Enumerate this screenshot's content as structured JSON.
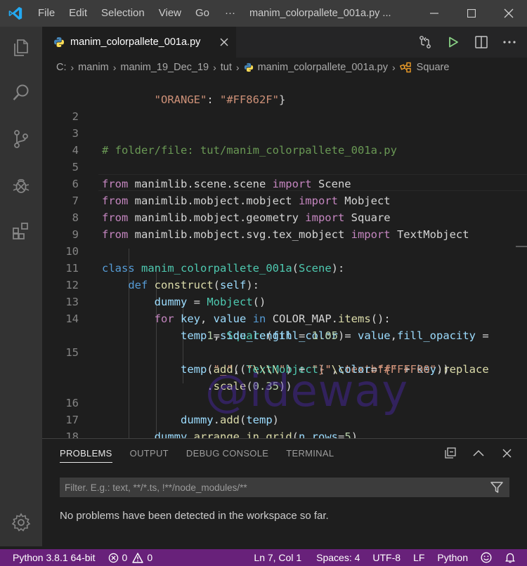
{
  "titlebar": {
    "menu": [
      "File",
      "Edit",
      "Selection",
      "View",
      "Go"
    ],
    "more": "···",
    "title": "manim_colorpallete_001a.py ..."
  },
  "tab": {
    "label": "manim_colorpallete_001a.py",
    "close": "×"
  },
  "breadcrumb": [
    "C:",
    "manim",
    "manim_19_Dec_19",
    "tut",
    "manim_colorpallete_001a.py",
    "Square"
  ],
  "editor": {
    "top_line_partial": "        \"ORANGE\": \"#FF862F\"}",
    "line_numbers": [
      "2",
      "3",
      "4",
      "5",
      "6",
      "7",
      "8",
      "9",
      "10",
      "11",
      "12",
      "13",
      "14",
      "15",
      "16",
      "17",
      "18"
    ],
    "watermark": "@ideway"
  },
  "panel": {
    "tabs": [
      "PROBLEMS",
      "OUTPUT",
      "DEBUG CONSOLE",
      "TERMINAL"
    ],
    "filter_placeholder": "Filter. E.g.: text, **/*.ts, !**/node_modules/**",
    "message": "No problems have been detected in the workspace so far."
  },
  "statusbar": {
    "python": "Python 3.8.1 64-bit",
    "errors": "0",
    "warnings": "0",
    "position": "Ln 7, Col 1",
    "spaces": "Spaces: 4",
    "encoding": "UTF-8",
    "eol": "LF",
    "language": "Python"
  },
  "colors": {
    "status_bar": "#68217a",
    "accent": "#007acc"
  }
}
